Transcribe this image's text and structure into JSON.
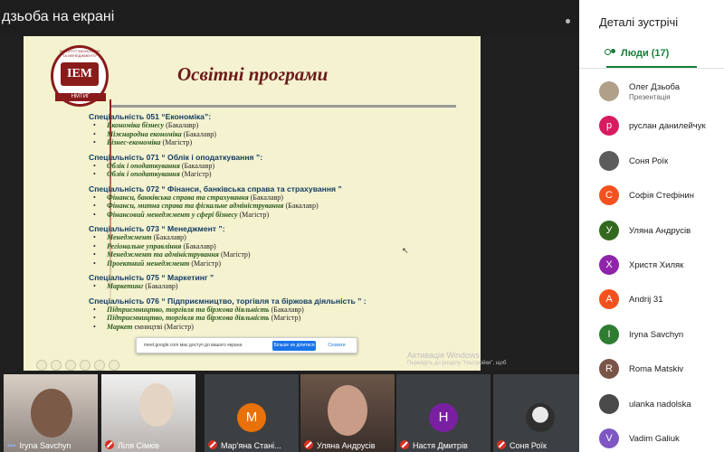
{
  "window": {
    "title": "дзьоба на екрані"
  },
  "slide": {
    "logo_text": "IEM",
    "logo_ring_text": "ІНСТИТУТ ЕКОНОМІКИ ТА МЕНЕДЖМЕНТУ",
    "logo_ribbon_text": "НМТИГ",
    "title": "Освітні програми",
    "groups": [
      {
        "heading": "Спеціальність 051 “Економіка”:",
        "items": [
          {
            "name": "Економіка бізнесу",
            "level": " (Бакалавр)"
          },
          {
            "name": "Міжнародна економіка",
            "level": " (Бакалавр)"
          },
          {
            "name": "Бізнес-економіка",
            "level": " (Магістр)"
          }
        ]
      },
      {
        "heading": "Спеціальність 071 “ Облік і оподаткування ”:",
        "items": [
          {
            "name": "Облік і оподаткування",
            "level": " (Бакалавр)"
          },
          {
            "name": "Облік і оподаткування",
            "level": " (Магістр)"
          }
        ]
      },
      {
        "heading": "Спеціальність 072 “ Фінанси, банківська справа та страхування ”",
        "items": [
          {
            "name": "Фінанси, банківська справа та страхування",
            "level": " (Бакалавр)"
          },
          {
            "name": "Фінанси, митна справа та фіскальне адміністрування",
            "level": " (Бакалавр)"
          },
          {
            "name": "Фінансовий менеджмент у сфері бізнесу",
            "level": " (Магістр)"
          }
        ]
      },
      {
        "heading": "Спеціальність 073 “ Менеджмент ”:",
        "items": [
          {
            "name": "Менеджмент",
            "level": " (Бакалавр)"
          },
          {
            "name": "Регіональне управління",
            "level": " (Бакалавр)"
          },
          {
            "name": "Менеджмент та адміністрування",
            "level": " (Магістр)"
          },
          {
            "name": "Проектний менеджмент",
            "level": " (Магістр)"
          }
        ]
      },
      {
        "heading": "Спеціальність 075 “ Маркетинг ”",
        "items": [
          {
            "name": "Маркетинг",
            "level": " (Бакалавр)"
          }
        ]
      },
      {
        "heading": "Спеціальність 076 “ Підприємництво, торгівля та біржова діяльність ” :",
        "items": [
          {
            "name": "Підприємництво, торгівля та біржова діяльність",
            "level": " (Бакалавр)"
          },
          {
            "name": "Підприємництво, торгівля та біржова діяльність",
            "level": " (Магістр)"
          },
          {
            "name": "Маркет",
            "level": "                                                     ємництві  (Магістр)"
          }
        ]
      }
    ]
  },
  "share_bar": {
    "message": "meet.google.com має доступ до вашого екрана",
    "stop_label": "Більше не ділитися",
    "hide_label": "Сховати"
  },
  "watermark": {
    "line1": "Активація Windows",
    "line2": "Перейдіть до розділу \"Настройки\", щоб"
  },
  "tiles": [
    {
      "name": "Iryna Savchyn",
      "muted": false,
      "speaking": true,
      "avatar": "",
      "color": ""
    },
    {
      "name": "Ліля Сімків",
      "muted": true,
      "avatar": "",
      "color": ""
    },
    {
      "name": "Мар'яна Стані...",
      "muted": true,
      "avatar": "М",
      "color": "#e8710a"
    },
    {
      "name": "Уляна Андрусів",
      "muted": true,
      "avatar": "",
      "color": ""
    },
    {
      "name": "Настя Дмитрів",
      "muted": true,
      "avatar": "Н",
      "color": "#7b1fa2"
    },
    {
      "name": "Соня Роїк",
      "muted": true,
      "avatar": "",
      "color": ""
    }
  ],
  "sidebar": {
    "title": "Деталі зустрічі",
    "people_tab": "Люди (17)",
    "people": [
      {
        "name": "Олег Дзьоба",
        "sub": "Презентація",
        "initial": "",
        "color": "#b0a08a"
      },
      {
        "name": "руслан данилейчук",
        "sub": "",
        "initial": "р",
        "color": "#d81b60"
      },
      {
        "name": "Соня Роїк",
        "sub": "",
        "initial": "",
        "color": "#5c5c5c"
      },
      {
        "name": "Софія Стефінин",
        "sub": "",
        "initial": "С",
        "color": "#f4511e"
      },
      {
        "name": "Уляна Андрусів",
        "sub": "",
        "initial": "У",
        "color": "#33691e"
      },
      {
        "name": "Христя Хиляк",
        "sub": "",
        "initial": "Х",
        "color": "#8e24aa"
      },
      {
        "name": "Andrij 31",
        "sub": "",
        "initial": "A",
        "color": "#f4511e"
      },
      {
        "name": "Iryna Savchyn",
        "sub": "",
        "initial": "I",
        "color": "#2e7d32"
      },
      {
        "name": "Roma Matskiv",
        "sub": "",
        "initial": "R",
        "color": "#795548"
      },
      {
        "name": "ulanka nadolska",
        "sub": "",
        "initial": "",
        "color": "#4a4a4a"
      },
      {
        "name": "Vadim Galiuk",
        "sub": "",
        "initial": "V",
        "color": "#7e57c2"
      }
    ]
  }
}
